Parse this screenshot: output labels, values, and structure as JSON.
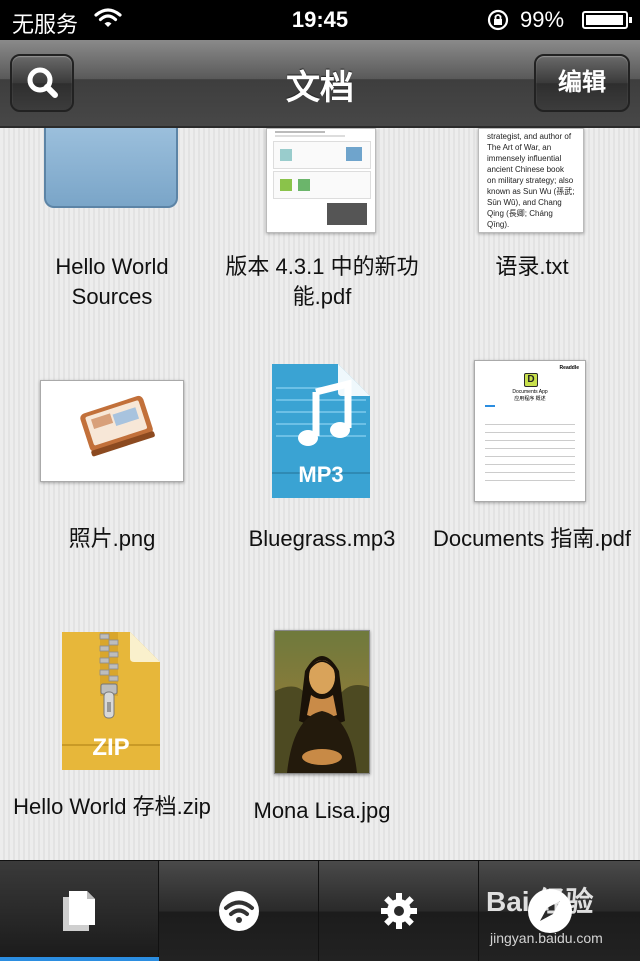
{
  "status_bar": {
    "carrier": "无服务",
    "time": "19:45",
    "battery_percent": "99%",
    "battery_level": 0.99
  },
  "nav": {
    "title": "文档",
    "edit_label": "编辑"
  },
  "files": [
    {
      "name": "Hello World Sources",
      "kind": "folder-icon"
    },
    {
      "name": "版本 4.3.1 中的新功能.pdf",
      "kind": "pdf-icon"
    },
    {
      "name": "语录.txt",
      "kind": "txt-icon"
    },
    {
      "name": "照片.png",
      "kind": "image-icon"
    },
    {
      "name": "Bluegrass.mp3",
      "kind": "mp3-icon"
    },
    {
      "name": "Documents 指南.pdf",
      "kind": "pdf-icon"
    },
    {
      "name": "Hello World 存档.zip",
      "kind": "zip-icon"
    },
    {
      "name": "Mona Lisa.jpg",
      "kind": "image-icon"
    }
  ],
  "previews": {
    "txt_excerpt": "strategist, and author of The Art of War, an immensely influential ancient Chinese book on military strategy; also known as Sun Wu (孫武; Sūn Wǔ), and Chang Qing (長卿; Cháng Qīng).",
    "mp3_badge": "MP3",
    "zip_badge": "ZIP",
    "doc_header": "Readdle",
    "doc_title": "Documents App",
    "doc_subtitle": "应用程序 概述",
    "doc_logo_letter": "D"
  },
  "watermark": {
    "brand": "Bai 经验",
    "url": "jingyan.baidu.com"
  },
  "tabs": [
    {
      "name": "documents-tab",
      "icon": "document-icon"
    },
    {
      "name": "wifi-tab",
      "icon": "wifi-icon"
    },
    {
      "name": "settings-tab",
      "icon": "gear-icon"
    },
    {
      "name": "browser-tab",
      "icon": "compass-icon"
    }
  ],
  "colors": {
    "accent": "#2b8de0",
    "folder": "#8bb3d6",
    "mp3": "#3aa3d3",
    "zip": "#e7b73a"
  }
}
